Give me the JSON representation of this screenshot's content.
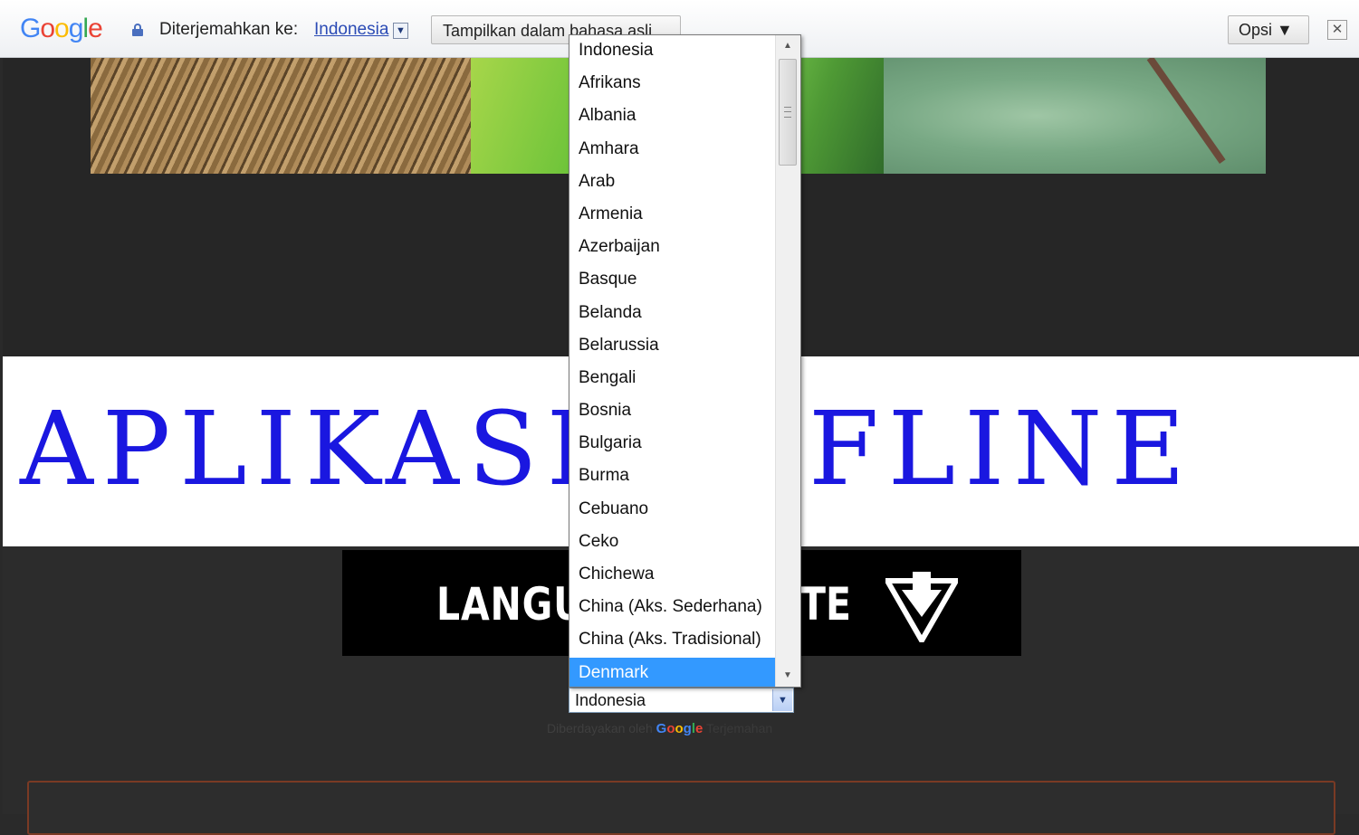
{
  "translate_bar": {
    "logo": "Google",
    "translated_to_label": "Diterjemahkan ke:",
    "current_language": "Indonesia",
    "show_original_label": "Tampilkan dalam bahasa asli",
    "options_label": "Opsi ▼",
    "close_symbol": "✕"
  },
  "site": {
    "title": "APLIKASI OFFLINE",
    "banner_text_left": "LANGUA",
    "banner_text_right": "TE"
  },
  "language_select": {
    "value": "Indonesia",
    "options": [
      "Indonesia",
      "Afrikans",
      "Albania",
      "Amhara",
      "Arab",
      "Armenia",
      "Azerbaijan",
      "Basque",
      "Belanda",
      "Belarussia",
      "Bengali",
      "Bosnia",
      "Bulgaria",
      "Burma",
      "Cebuano",
      "Ceko",
      "Chichewa",
      "China (Aks. Sederhana)",
      "China (Aks. Tradisional)",
      "Denmark"
    ],
    "highlighted": "Denmark"
  },
  "powered_by": {
    "prefix": "Diberdayakan oleh",
    "brand": "Google",
    "suffix": "Terjemahan"
  },
  "colors": {
    "title_blue": "#1a17e0",
    "highlight": "#3399ff",
    "link": "#2b4bb5"
  }
}
